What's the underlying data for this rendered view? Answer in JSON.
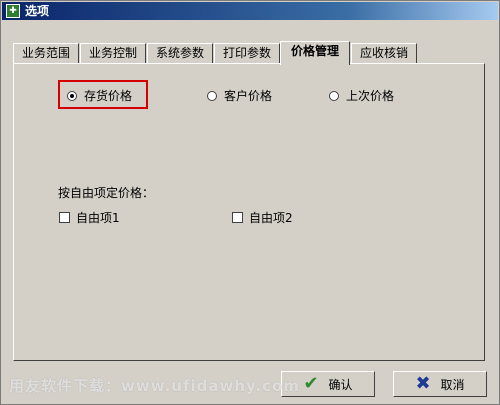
{
  "window": {
    "title": "选项"
  },
  "tabs": [
    {
      "label": "业务范围"
    },
    {
      "label": "业务控制"
    },
    {
      "label": "系统参数"
    },
    {
      "label": "打印参数"
    },
    {
      "label": "价格管理",
      "active": true
    },
    {
      "label": "应收核销"
    }
  ],
  "price": {
    "options": [
      {
        "label": "存货价格",
        "checked": true
      },
      {
        "label": "客户价格",
        "checked": false
      },
      {
        "label": "上次价格",
        "checked": false
      }
    ],
    "free_item_label": "按自由项定价格：",
    "free_items": [
      {
        "label": "自由项1",
        "checked": false
      },
      {
        "label": "自由项2",
        "checked": false
      }
    ]
  },
  "buttons": {
    "ok": "确认",
    "cancel": "取消"
  },
  "colors": {
    "highlight": "#d40000",
    "ok_icon": "#2e8b2e",
    "cancel_icon": "#1f3a93"
  },
  "watermark": "用友软件下载：www.ufidawhy.com"
}
